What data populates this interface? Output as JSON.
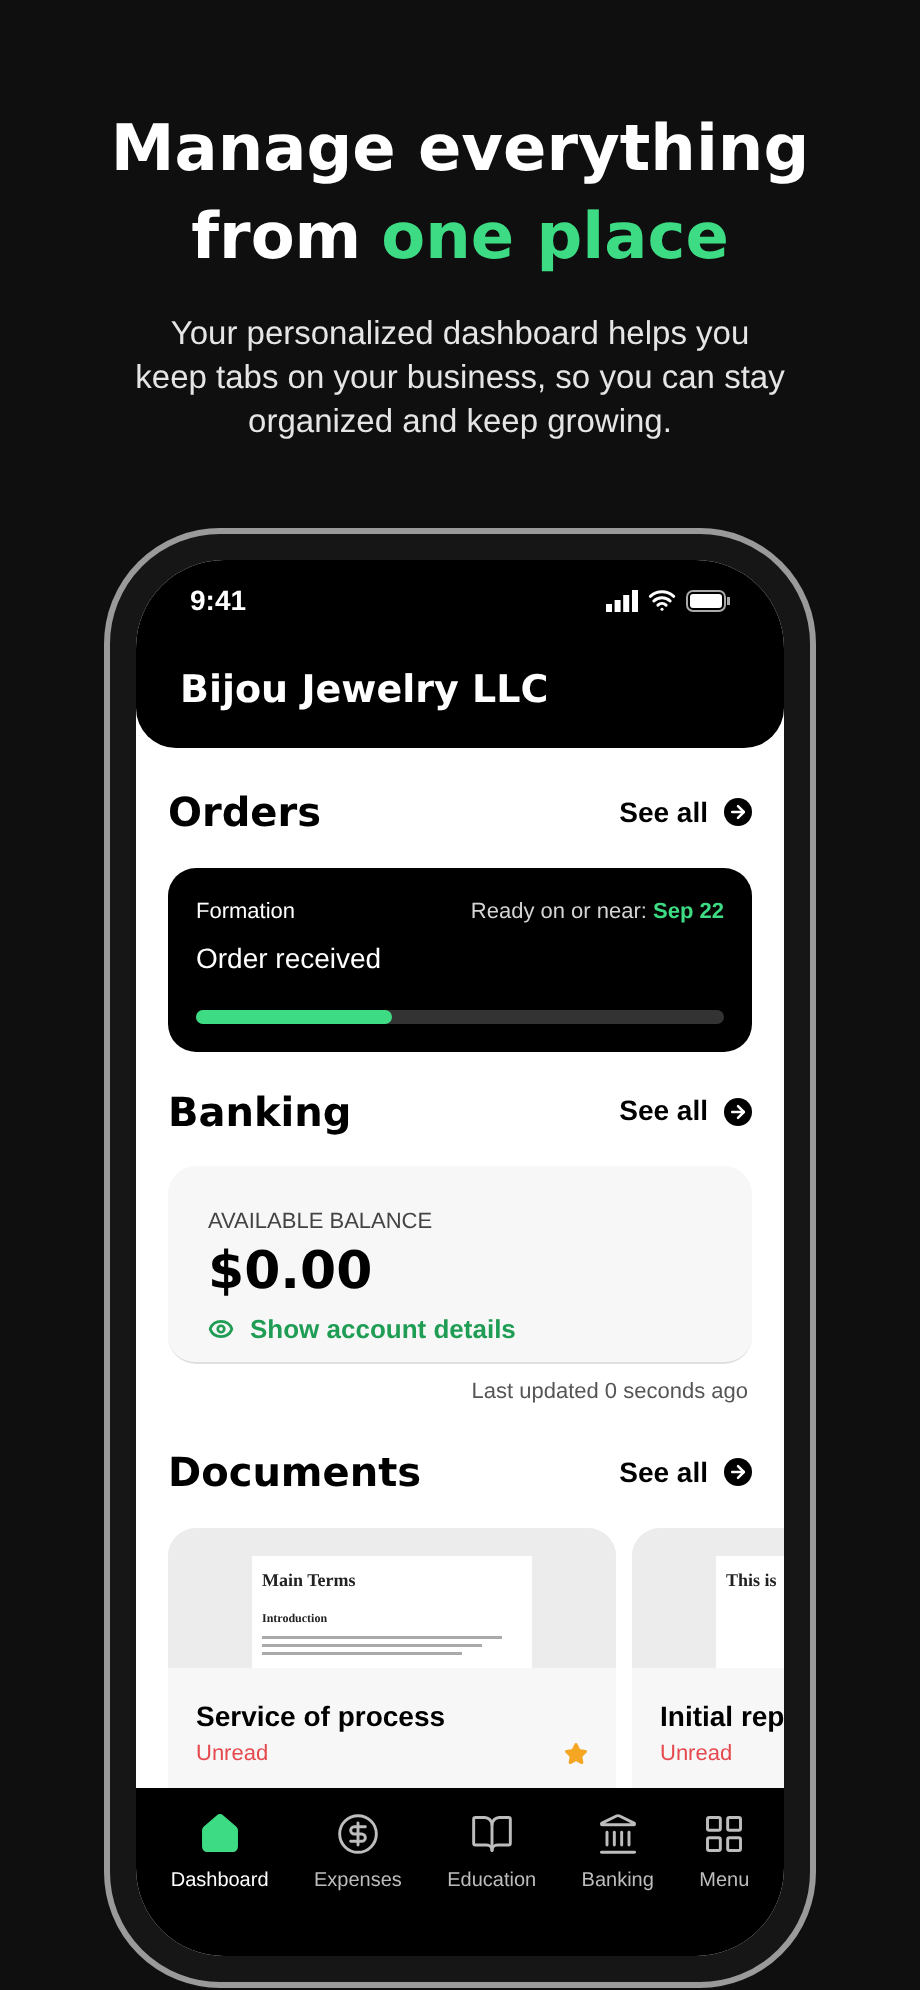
{
  "headline": [
    {
      "text": "Manage everything",
      "highlight": false
    },
    {
      "text": "from",
      "highlight": false
    },
    {
      "text": "one place",
      "highlight": true
    }
  ],
  "subtitle": "Your personalized dashboard helps you keep tabs on your business, so you can stay organized and keep growing.",
  "status_bar": {
    "time": "9:41"
  },
  "header": {
    "title": "Bijou Jewelry LLC"
  },
  "orders": {
    "title": "Orders",
    "see_all": "See all",
    "card": {
      "category": "Formation",
      "ready_label": "Ready on or near:",
      "ready_date": "Sep 22",
      "status": "Order received",
      "level": 0.37
    }
  },
  "banking": {
    "title": "Banking",
    "see_all": "See all",
    "balance_label": "AVAILABLE BALANCE",
    "balance": "$0.00",
    "show_details": "Show account details",
    "last_updated": "Last updated 0 seconds ago"
  },
  "documents": {
    "title": "Documents",
    "see_all": "See all",
    "items": [
      {
        "preview_title": "Main Terms",
        "preview_heading": "Introduction",
        "name": "Service of process",
        "status": "Unread",
        "starred": true
      },
      {
        "preview_title": "This is",
        "name": "Initial rep",
        "status": "Unread"
      }
    ]
  },
  "tab_bar": [
    {
      "label": "Dashboard",
      "selected": true
    },
    {
      "label": "Expenses",
      "selected": false
    },
    {
      "label": "Education",
      "selected": false
    },
    {
      "label": "Banking",
      "selected": false
    },
    {
      "label": "Menu",
      "selected": false
    }
  ]
}
